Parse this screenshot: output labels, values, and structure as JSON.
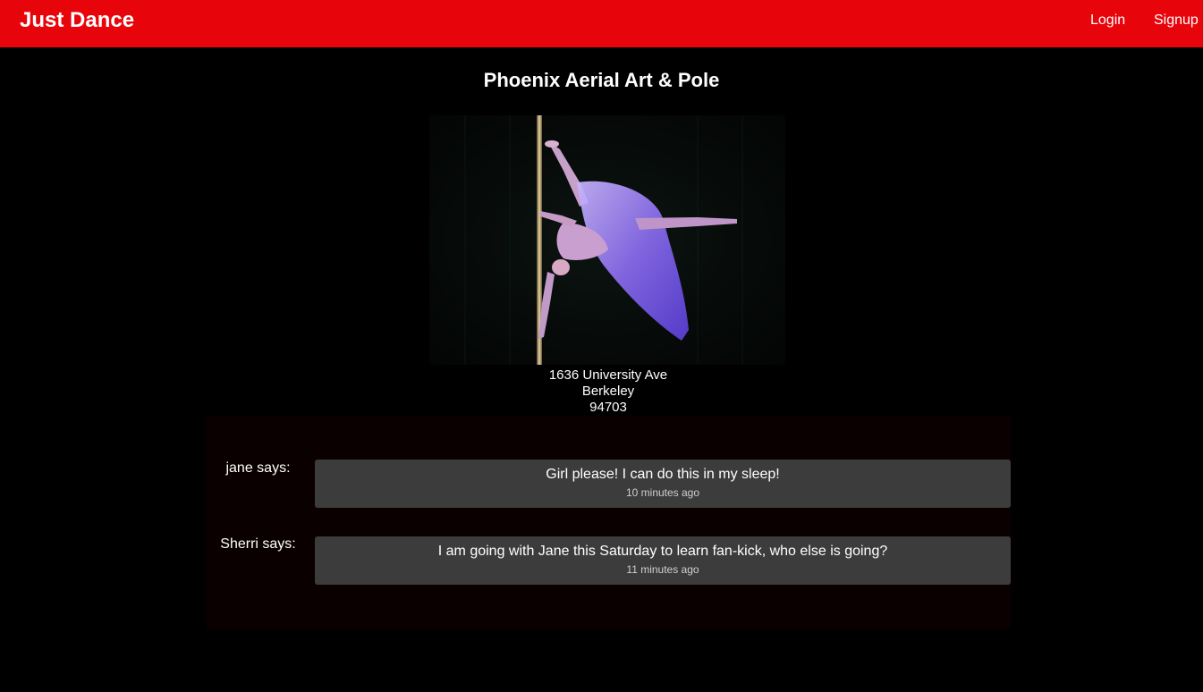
{
  "nav": {
    "brand": "Just Dance",
    "login": "Login",
    "signup": "Signup",
    "color": "#e8040b"
  },
  "studio": {
    "name": "Phoenix Aerial Art & Pole",
    "photo_alt": "aerial-pole-dancer-photo",
    "address": {
      "street": "1636 University Ave",
      "city": "Berkeley",
      "zip": "94703"
    }
  },
  "comments": [
    {
      "author": "jane says:",
      "text": "Girl please! I can do this in my sleep!",
      "time": "10 minutes ago"
    },
    {
      "author": "Sherri says:",
      "text": "I am going with Jane this Saturday to learn fan-kick, who else is going?",
      "time": "11 minutes ago"
    }
  ]
}
